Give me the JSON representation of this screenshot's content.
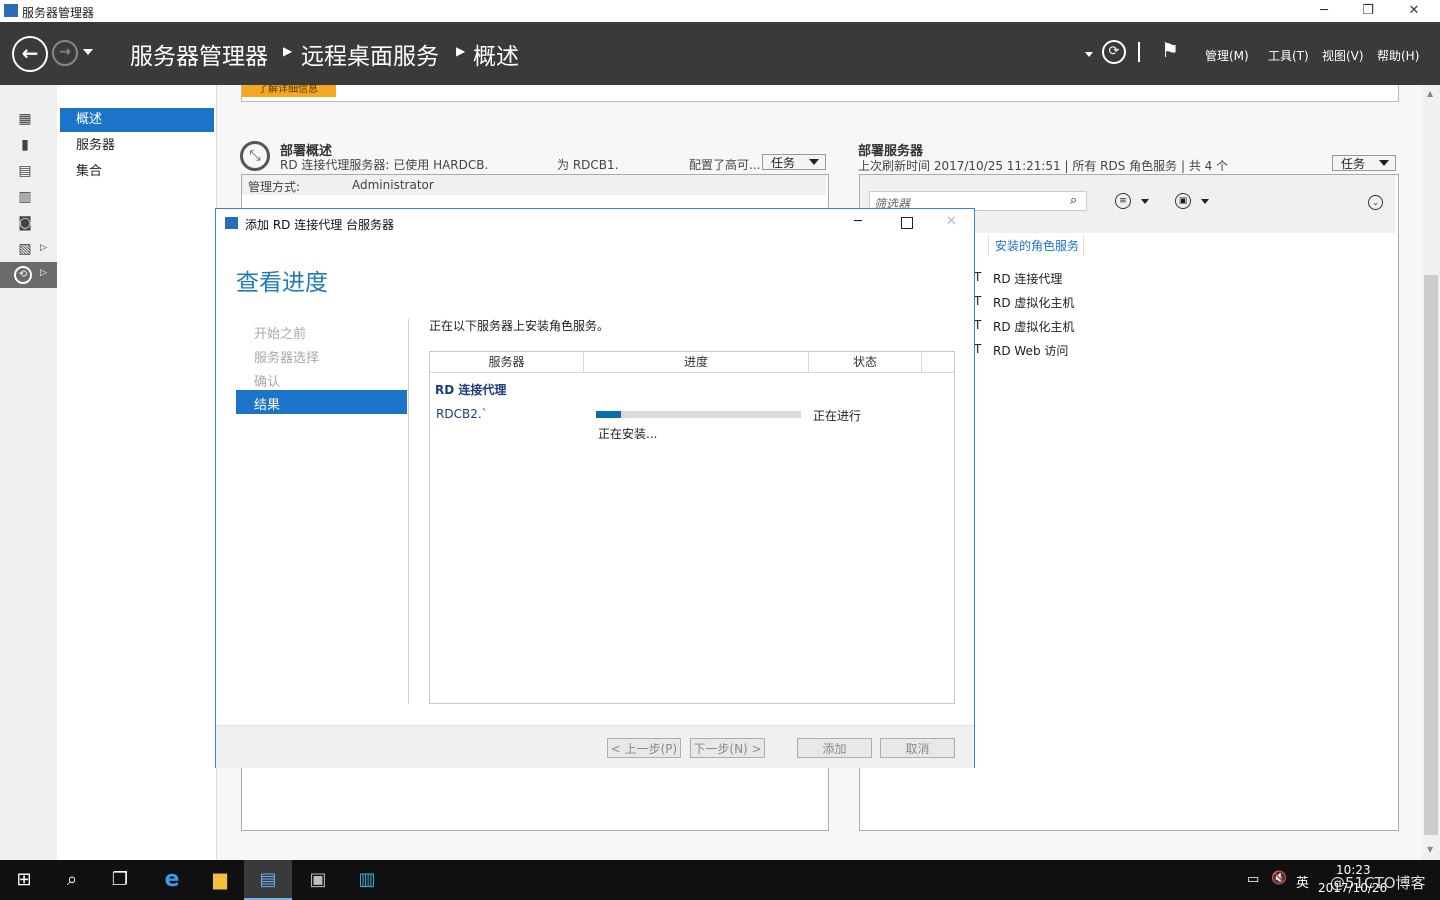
{
  "window": {
    "title": "服务器管理器"
  },
  "header": {
    "breadcrumb": [
      "服务器管理器",
      "远程桌面服务",
      "概述"
    ],
    "menus": [
      "管理(M)",
      "工具(T)",
      "视图(V)",
      "帮助(H)"
    ]
  },
  "nav": {
    "items": [
      "概述",
      "服务器",
      "集合"
    ]
  },
  "banner": {
    "text": "了解详细信息"
  },
  "deploy_overview": {
    "title": "部署概述",
    "subtitle": "RD 连接代理服务器: 已使用 HARDCB.",
    "subtitle_mid": "为 RDCB1.",
    "subtitle_end": "配置了高可...",
    "task_label": "任务",
    "manage_label": "管理方式:",
    "manage_value": "Administrator"
  },
  "deploy_servers": {
    "title": "部署服务器",
    "subtitle": "上次刷新时间 2017/10/25 11:21:51 | 所有 RDS 角色服务 | 共 4 个",
    "task_label": "任务",
    "filter_placeholder": "筛选器",
    "column_header": "安装的角色服务",
    "rows": [
      "RD 连接代理",
      "RD 虚拟化主机",
      "RD 虚拟化主机",
      "RD Web 访问"
    ],
    "row_prefix": "T"
  },
  "dialog": {
    "title": "添加 RD 连接代理 台服务器",
    "heading": "查看进度",
    "steps": [
      "开始之前",
      "服务器选择",
      "确认",
      "结果"
    ],
    "intro": "正在以下服务器上安装角色服务。",
    "table_headers": [
      "服务器",
      "进度",
      "状态"
    ],
    "group_label": "RD 连接代理",
    "server_name": "RDCB2.`",
    "progress": 0.12,
    "status_text": "正在进行",
    "progress_caption": "正在安装...",
    "buttons": {
      "prev": "< 上一步(P)",
      "next": "下一步(N) >",
      "add": "添加",
      "cancel": "取消"
    }
  },
  "taskbar": {
    "ime": "英",
    "time": "10:23",
    "date": "2017/10/26",
    "watermark": "@51CTO博客"
  },
  "colors": {
    "accent": "#1c74c8",
    "header_bg": "#3a3a3a",
    "progress": "#0a6ea8",
    "heading": "#1f7ab8"
  }
}
